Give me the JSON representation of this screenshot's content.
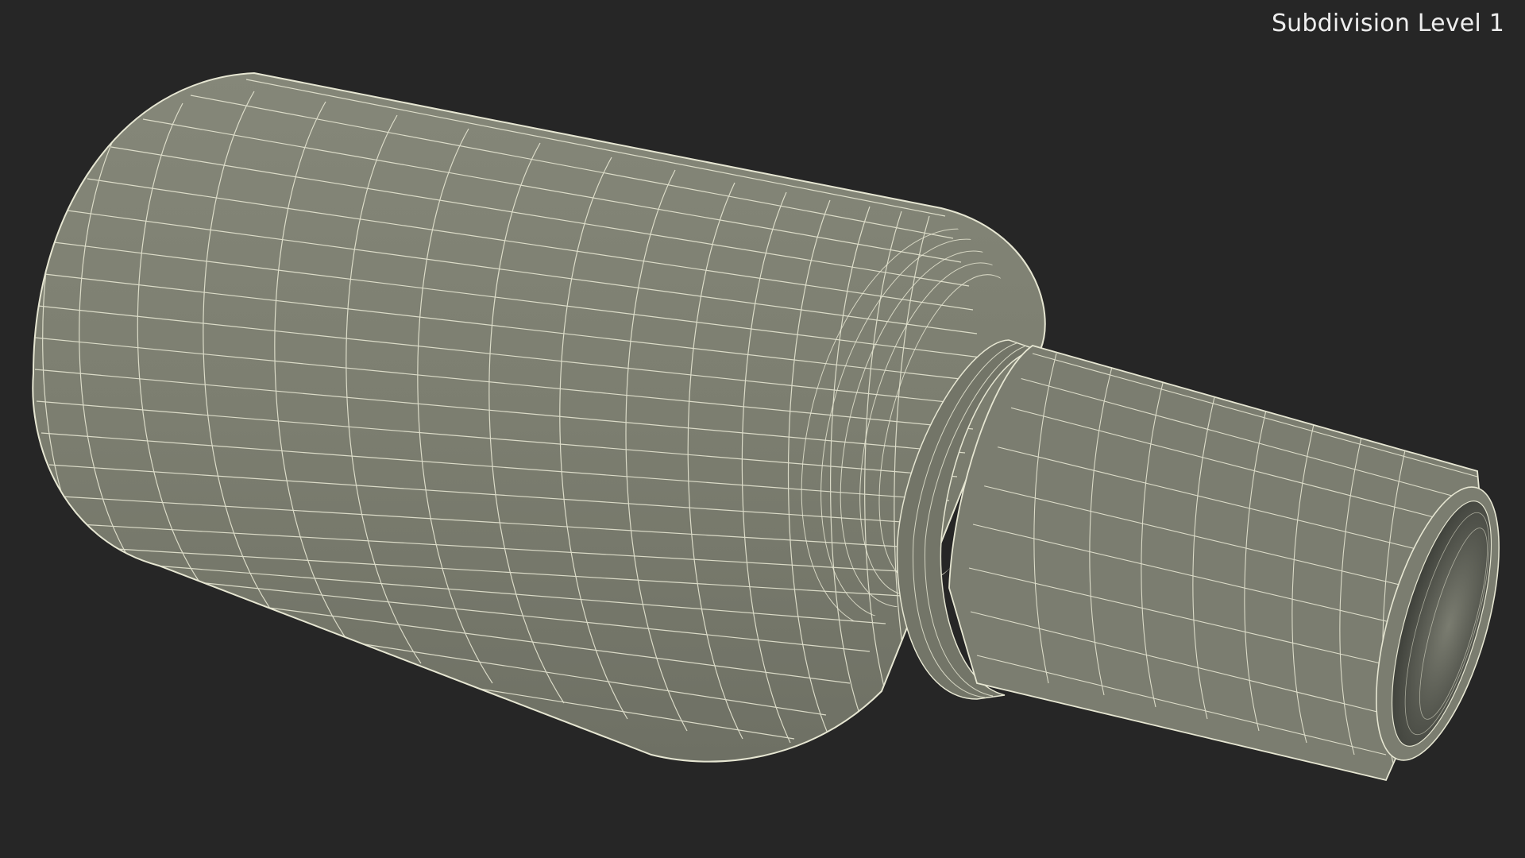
{
  "viewport": {
    "label": "Subdivision Level 1",
    "background_color": "#262626"
  },
  "model": {
    "surface_color": "#7c7e70",
    "wire_color": "#e6e6d2",
    "cavity_color": "#5d5f55"
  }
}
